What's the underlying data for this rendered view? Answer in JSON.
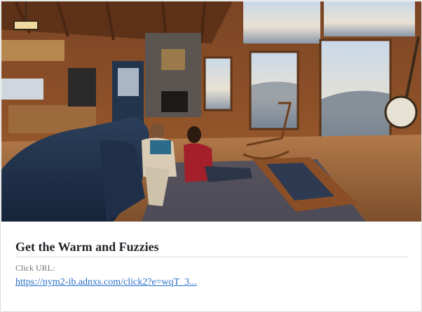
{
  "ad": {
    "title": "Get the Warm and Fuzzies",
    "click_url_label": "Click URL:",
    "click_url": "https://nym2-ib.adnxs.com/click2?e=wqT_3..."
  },
  "colors": {
    "title": "#1f2328",
    "label": "#707070",
    "link": "#2a6fc9",
    "divider": "#dcdfe3"
  }
}
